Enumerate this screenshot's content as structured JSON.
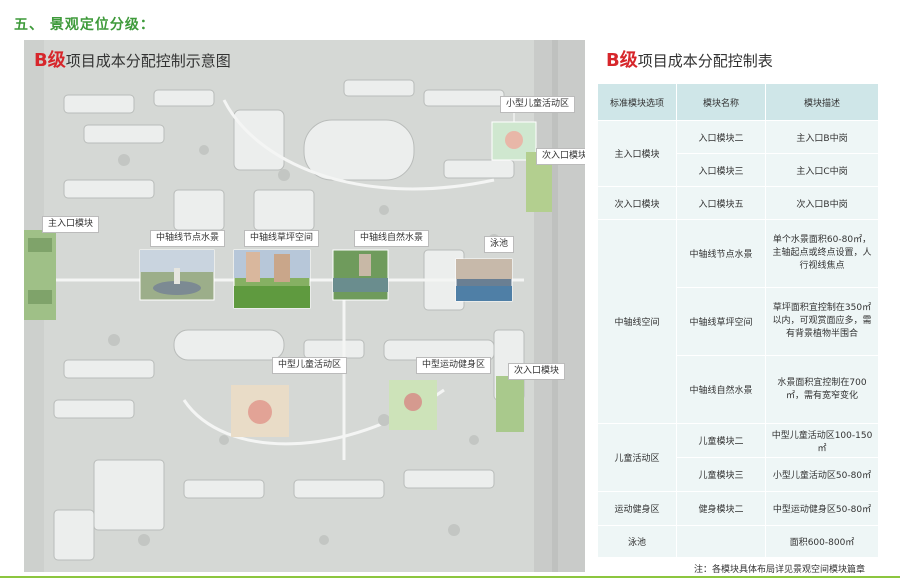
{
  "section_title": "五、 景观定位分级：",
  "map": {
    "title_grade": "B级",
    "title_text": "项目成本分配控制示意图",
    "labels": {
      "small_kids": "小型儿童活动区",
      "secondary_entrance_1": "次入口模块",
      "main_entrance": "主入口模块",
      "axis_node": "中轴线节点水景",
      "axis_lawn": "中轴线草坪空间",
      "axis_nature": "中轴线自然水景",
      "pool": "泳池",
      "mid_kids": "中型儿童活动区",
      "mid_fitness": "中型运动健身区",
      "secondary_entrance_2": "次入口模块"
    }
  },
  "table": {
    "title_grade": "B级",
    "title_text": "项目成本分配控制表",
    "headers": [
      "标准模块选项",
      "模块名称",
      "模块描述"
    ],
    "rows": [
      {
        "option": "主入口模块",
        "name": "入口模块二",
        "desc": "主入口B中岗"
      },
      {
        "name": "入口模块三",
        "desc": "主入口C中岗"
      },
      {
        "option": "次入口模块",
        "name": "入口模块五",
        "desc": "次入口B中岗"
      },
      {
        "option": "中轴线空间",
        "name": "中轴线节点水景",
        "desc": "单个水景面积60-80㎡，主轴起点或终点设置，人行视线焦点"
      },
      {
        "name": "中轴线草坪空间",
        "desc": "草坪面积宜控制在350㎡以内，可观赏面应多，需有背景植物半围合"
      },
      {
        "name": "中轴线自然水景",
        "desc": "水景面积宜控制在700㎡，需有宽窄变化"
      },
      {
        "option": "儿童活动区",
        "name": "儿童模块二",
        "desc": "中型儿童活动区100-150㎡"
      },
      {
        "name": "儿童模块三",
        "desc": "小型儿童活动区50-80㎡"
      },
      {
        "option": "运动健身区",
        "name": "健身模块二",
        "desc": "中型运动健身区50-80㎡"
      },
      {
        "option": "泳池",
        "name": "",
        "desc": "面积600-800㎡"
      }
    ],
    "note": "注：各模块具体布局详见景观空间模块篇章"
  }
}
